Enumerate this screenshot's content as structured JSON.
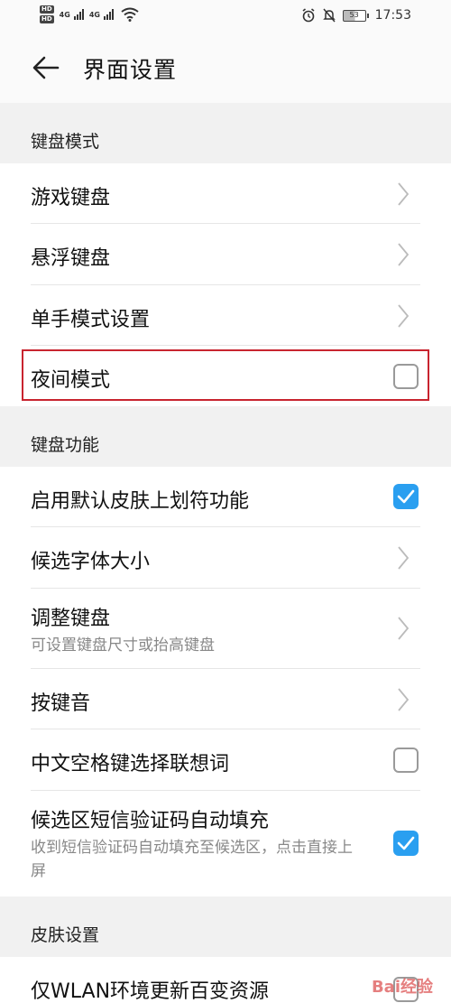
{
  "status_bar": {
    "hd_1": "HD",
    "hd_2": "HD",
    "net_1": "4G",
    "net_2": "4G",
    "battery": "53",
    "time": "17:53"
  },
  "header": {
    "title": "界面设置"
  },
  "sections": {
    "keyboard_mode": {
      "title": "键盘模式",
      "items": [
        {
          "label": "游戏键盘"
        },
        {
          "label": "悬浮键盘"
        },
        {
          "label": "单手模式设置"
        },
        {
          "label": "夜间模式",
          "checked": false
        }
      ]
    },
    "keyboard_function": {
      "title": "键盘功能",
      "items": [
        {
          "label": "启用默认皮肤上划符功能",
          "checked": true
        },
        {
          "label": "候选字体大小"
        },
        {
          "label": "调整键盘",
          "subtitle": "可设置键盘尺寸或抬高键盘"
        },
        {
          "label": "按键音"
        },
        {
          "label": "中文空格键选择联想词",
          "checked": false
        },
        {
          "label": "候选区短信验证码自动填充",
          "subtitle": "收到短信验证码自动填充至候选区，点击直接上屏",
          "checked": true
        }
      ]
    },
    "skin_settings": {
      "title": "皮肤设置",
      "items": [
        {
          "label": "仅WLAN环境更新百变资源"
        }
      ]
    }
  },
  "colors": {
    "accent": "#2a9ff0",
    "highlight": "#c8242f"
  },
  "watermark": "Bai经验"
}
